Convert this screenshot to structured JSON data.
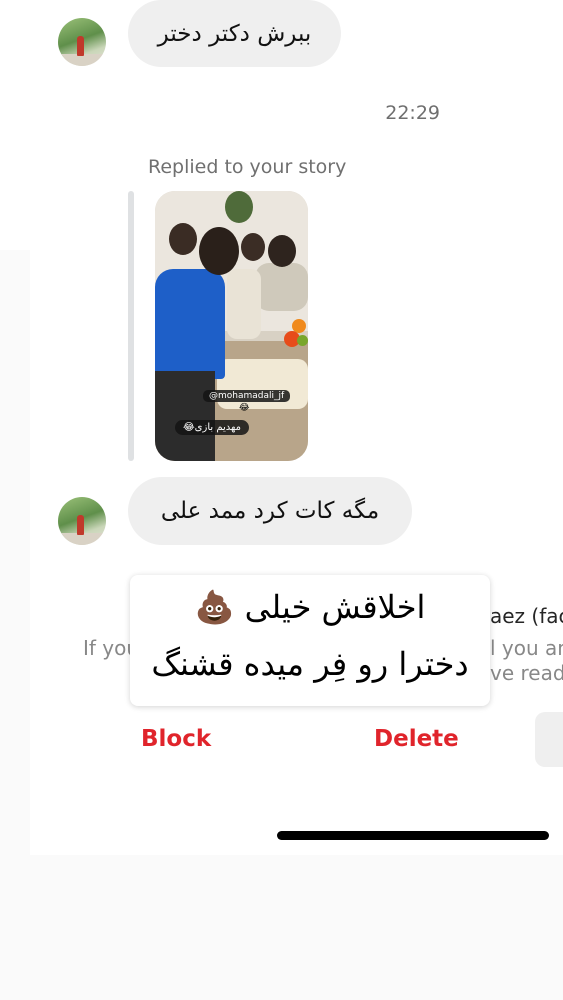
{
  "messages": [
    {
      "text": "ببرش دکتر دختر"
    },
    {
      "text": "مگه کات کرد ممد علی"
    }
  ],
  "timestamp": "22:29",
  "reply": {
    "label": "Replied to your story",
    "story_handle": "@mohamadali_jf",
    "story_emoji": "😂",
    "story_caption": "مهدیم بازی😂"
  },
  "request_banner": {
    "name_fragment": "aez (fac",
    "line1_left": "If you",
    "line1_right": "l you an",
    "line2_right": "ve read"
  },
  "actions": {
    "block_label": "Block",
    "delete_label": "Delete"
  },
  "overlay_caption": {
    "line1": "اخلاقش خیلی 💩",
    "line2": "دخترا رو فِر میده قشنگ"
  },
  "colors": {
    "bubble": "#efefef",
    "destructive": "#e0242b",
    "secondary_text": "#707070"
  }
}
